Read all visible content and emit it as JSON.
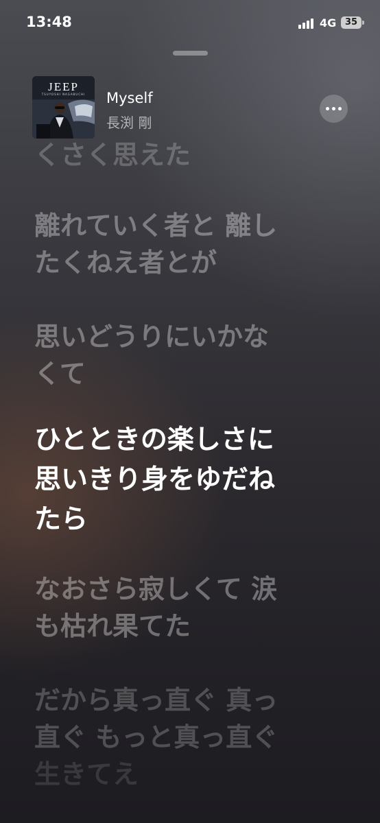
{
  "status_bar": {
    "time": "13:48",
    "network": "4G",
    "battery": "35"
  },
  "now_playing": {
    "title": "Myself",
    "artist": "長渕 剛",
    "album_art_text": "JEEP",
    "album_art_subtext": "TSUYOSHI NAGABUCHI"
  },
  "lyrics": [
    "くさく思えた",
    "離れていく者と 離したくねえ者とが",
    "思いどうりにいかなくて",
    "ひとときの楽しさに 思いきり身をゆだねたら",
    "なおさら寂しくて 涙も枯れ果てた",
    "だから真っ直ぐ 真っ直ぐ もっと真っ直ぐ 生きてえ"
  ],
  "lyrics_display": {
    "line0": "くさく思えた",
    "line1a": "離れていく者と 離し",
    "line1b": "たくねえ者とが",
    "line2a": "思いどうりにいかな",
    "line2b": "くて",
    "line3a": "ひとときの楽しさに",
    "line3b": "思いきり身をゆだね",
    "line3c": "たら",
    "line4a": "なおさら寂しくて 涙",
    "line4b": "も枯れ果てた",
    "line5a": "だから真っ直ぐ 真っ",
    "line5b": "直ぐ もっと真っ直ぐ",
    "line5c": "生きてえ"
  },
  "icons": {
    "signal": "cellular-signal-icon",
    "battery": "battery-icon",
    "more": "more-options-icon"
  }
}
